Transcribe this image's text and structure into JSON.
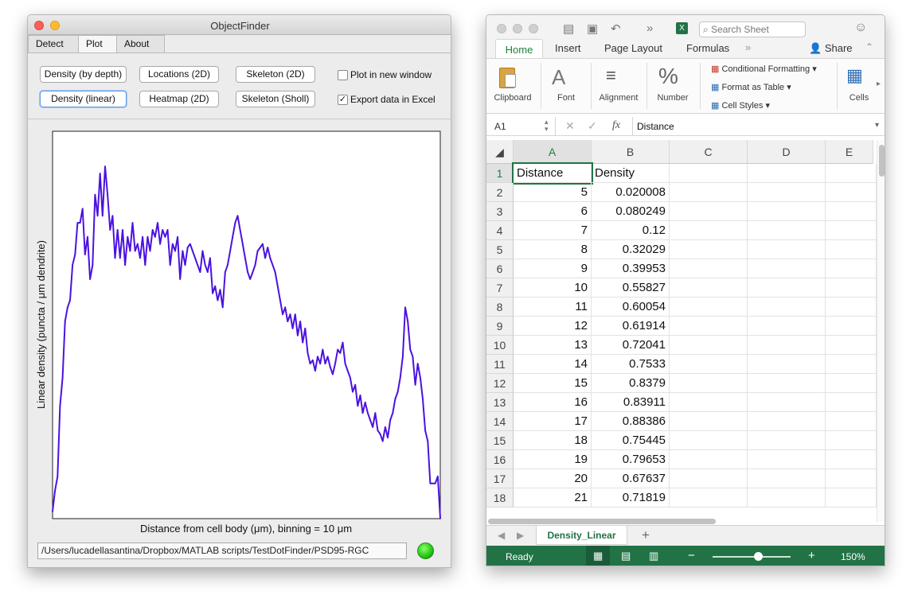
{
  "objectfinder": {
    "title": "ObjectFinder",
    "tabs": [
      {
        "label": "Detect",
        "active": false
      },
      {
        "label": "Plot",
        "active": true
      },
      {
        "label": "About",
        "active": false
      }
    ],
    "buttons": {
      "density_depth": "Density (by depth)",
      "locations_2d": "Locations (2D)",
      "skeleton_2d": "Skeleton (2D)",
      "density_linear": "Density (linear)",
      "heatmap_2d": "Heatmap (2D)",
      "skeleton_sholl": "Skeleton (Sholl)"
    },
    "checkboxes": {
      "plot_new_window": {
        "label": "Plot in new window",
        "checked": false
      },
      "export_excel": {
        "label": "Export data in Excel",
        "checked": true
      }
    },
    "path": "/Users/lucadellasantina/Dropbox/MATLAB scripts/TestDotFinder/PSD95-RGC",
    "status_color": "#22c512"
  },
  "chart_data": {
    "type": "line",
    "xlabel": "Distance from cell body (μm), binning = 10 μm",
    "ylabel": "Linear density (puncta / μm dendrite)",
    "color": "#4b12e0",
    "grid": false,
    "xlim": [
      5,
      160
    ],
    "ylim": [
      0,
      1.1
    ],
    "x": [
      5,
      6,
      7,
      8,
      9,
      10,
      11,
      12,
      13,
      14,
      15,
      16,
      17,
      18,
      19,
      20,
      21,
      22,
      23,
      24,
      25,
      26,
      27,
      28,
      29,
      30,
      31,
      32,
      33,
      34,
      35,
      36,
      37,
      38,
      39,
      40,
      41,
      42,
      43,
      44,
      45,
      46,
      47,
      48,
      49,
      50,
      51,
      52,
      53,
      54,
      55,
      56,
      57,
      58,
      59,
      60,
      61,
      62,
      63,
      64,
      65,
      66,
      67,
      68,
      69,
      70,
      71,
      72,
      73,
      74,
      75,
      76,
      77,
      78,
      79,
      80,
      81,
      82,
      83,
      84,
      85,
      86,
      87,
      88,
      89,
      90,
      91,
      92,
      93,
      94,
      95,
      96,
      97,
      98,
      99,
      100,
      101,
      102,
      103,
      104,
      105,
      106,
      107,
      108,
      109,
      110,
      111,
      112,
      113,
      114,
      115,
      116,
      117,
      118,
      119,
      120,
      121,
      122,
      123,
      124,
      125,
      126,
      127,
      128,
      129,
      130,
      131,
      132,
      133,
      134,
      135,
      136,
      137,
      138,
      139,
      140,
      141,
      142,
      143,
      144,
      145,
      146,
      147,
      148,
      149,
      150,
      151,
      152,
      153,
      154,
      155,
      156,
      157,
      158,
      159,
      160
    ],
    "values": [
      0.02,
      0.08,
      0.12,
      0.32,
      0.4,
      0.56,
      0.6,
      0.62,
      0.72,
      0.75,
      0.84,
      0.84,
      0.88,
      0.75,
      0.8,
      0.68,
      0.72,
      0.92,
      0.86,
      0.98,
      0.86,
      1.0,
      0.92,
      0.82,
      0.86,
      0.74,
      0.82,
      0.74,
      0.82,
      0.72,
      0.8,
      0.76,
      0.84,
      0.76,
      0.78,
      0.74,
      0.8,
      0.72,
      0.8,
      0.76,
      0.82,
      0.8,
      0.84,
      0.78,
      0.82,
      0.8,
      0.82,
      0.72,
      0.78,
      0.76,
      0.8,
      0.68,
      0.76,
      0.72,
      0.77,
      0.78,
      0.76,
      0.74,
      0.72,
      0.7,
      0.76,
      0.72,
      0.7,
      0.74,
      0.64,
      0.66,
      0.62,
      0.65,
      0.6,
      0.7,
      0.72,
      0.76,
      0.8,
      0.84,
      0.86,
      0.82,
      0.78,
      0.74,
      0.7,
      0.68,
      0.7,
      0.72,
      0.76,
      0.77,
      0.78,
      0.74,
      0.77,
      0.74,
      0.72,
      0.7,
      0.66,
      0.62,
      0.58,
      0.6,
      0.56,
      0.58,
      0.54,
      0.58,
      0.52,
      0.56,
      0.5,
      0.54,
      0.47,
      0.44,
      0.45,
      0.42,
      0.46,
      0.44,
      0.48,
      0.44,
      0.46,
      0.43,
      0.41,
      0.44,
      0.48,
      0.47,
      0.5,
      0.44,
      0.42,
      0.4,
      0.36,
      0.38,
      0.32,
      0.35,
      0.3,
      0.33,
      0.3,
      0.28,
      0.26,
      0.3,
      0.25,
      0.24,
      0.22,
      0.26,
      0.23,
      0.28,
      0.3,
      0.34,
      0.36,
      0.4,
      0.46,
      0.6,
      0.56,
      0.48,
      0.46,
      0.38,
      0.44,
      0.4,
      0.34,
      0.25,
      0.22,
      0.1,
      0.1,
      0.1,
      0.12,
      0.0
    ]
  },
  "excel": {
    "search_placeholder": "Search Sheet",
    "share_label": "Share",
    "ribbon_tabs": [
      "Home",
      "Insert",
      "Page Layout",
      "Formulas"
    ],
    "ribbon_groups": {
      "clipboard": "Clipboard",
      "font": "Font",
      "alignment": "Alignment",
      "number": "Number",
      "cells": "Cells",
      "conditional_formatting": "Conditional Formatting",
      "format_as_table": "Format as Table",
      "cell_styles": "Cell Styles"
    },
    "name_box": "A1",
    "fx_label": "fx",
    "formula_value": "Distance",
    "columns": [
      "A",
      "B",
      "C",
      "D",
      "E"
    ],
    "rows": [
      {
        "n": "1",
        "a": "Distance",
        "b": "Density"
      },
      {
        "n": "2",
        "a": "5",
        "b": "0.020008"
      },
      {
        "n": "3",
        "a": "6",
        "b": "0.080249"
      },
      {
        "n": "4",
        "a": "7",
        "b": "0.12"
      },
      {
        "n": "5",
        "a": "8",
        "b": "0.32029"
      },
      {
        "n": "6",
        "a": "9",
        "b": "0.39953"
      },
      {
        "n": "7",
        "a": "10",
        "b": "0.55827"
      },
      {
        "n": "8",
        "a": "11",
        "b": "0.60054"
      },
      {
        "n": "9",
        "a": "12",
        "b": "0.61914"
      },
      {
        "n": "10",
        "a": "13",
        "b": "0.72041"
      },
      {
        "n": "11",
        "a": "14",
        "b": "0.7533"
      },
      {
        "n": "12",
        "a": "15",
        "b": "0.8379"
      },
      {
        "n": "13",
        "a": "16",
        "b": "0.83911"
      },
      {
        "n": "14",
        "a": "17",
        "b": "0.88386"
      },
      {
        "n": "15",
        "a": "18",
        "b": "0.75445"
      },
      {
        "n": "16",
        "a": "19",
        "b": "0.79653"
      },
      {
        "n": "17",
        "a": "20",
        "b": "0.67637"
      },
      {
        "n": "18",
        "a": "21",
        "b": "0.71819"
      }
    ],
    "sheet_tab": "Density_Linear",
    "status": "Ready",
    "zoom": "150%",
    "accent": "#217346"
  }
}
